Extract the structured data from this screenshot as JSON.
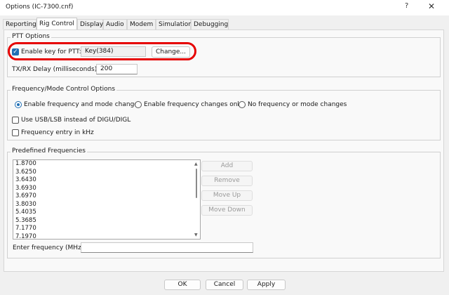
{
  "window": {
    "title": "Options (IC-7300.cnf)",
    "help_icon": "?",
    "close_icon": "✕"
  },
  "tabs": [
    {
      "label": "Reporting"
    },
    {
      "label": "Rig Control",
      "active": true
    },
    {
      "label": "Display"
    },
    {
      "label": "Audio"
    },
    {
      "label": "Modem"
    },
    {
      "label": "Simulation"
    },
    {
      "label": "Debugging"
    }
  ],
  "ptt": {
    "group_label": "PTT Options",
    "enable_key_label": "Enable key for PTT:",
    "enable_key_checked": true,
    "key_value": "Key(384)",
    "change_button": "Change...",
    "delay_label": "TX/RX Delay (milliseconds):",
    "delay_value": "200"
  },
  "freq_mode": {
    "group_label": "Frequency/Mode Control Options",
    "radio_options": [
      "Enable frequency and mode changes",
      "Enable frequency changes only",
      "No frequency or mode changes"
    ],
    "selected_option": "Enable frequency and mode changes",
    "usb_lsb_label": "Use USB/LSB instead of DIGU/DIGL",
    "khz_label": "Frequency entry in kHz"
  },
  "predefined": {
    "group_label": "Predefined Frequencies",
    "frequencies": [
      "1.8700",
      "3.6250",
      "3.6430",
      "3.6930",
      "3.6970",
      "3.8030",
      "5.4035",
      "5.3685",
      "7.1770",
      "7.1970"
    ],
    "buttons": {
      "add": "Add",
      "remove": "Remove",
      "move_up": "Move Up",
      "move_down": "Move Down"
    },
    "enter_label": "Enter frequency (MHz):",
    "enter_value": ""
  },
  "footer": {
    "ok": "OK",
    "cancel": "Cancel",
    "apply": "Apply"
  },
  "colors": {
    "accent": "#1f6fb5",
    "highlight_ring": "#e60000"
  }
}
